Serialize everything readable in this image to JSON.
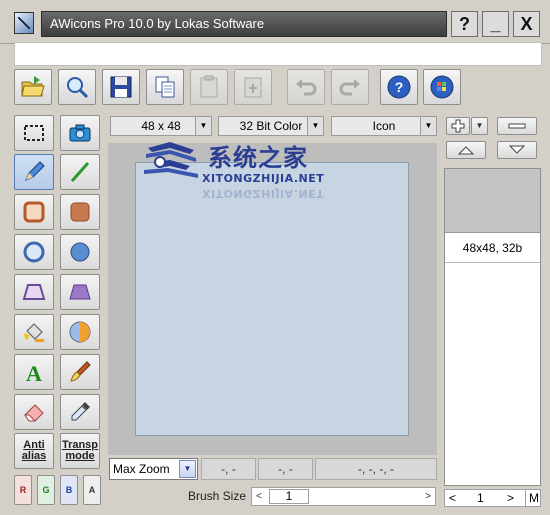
{
  "window": {
    "title": "AWicons Pro 10.0 by Lokas Software",
    "help_label": "?",
    "minimize_label": "_",
    "close_label": "X"
  },
  "toolbar": {
    "buttons": [
      {
        "name": "open",
        "icon": "folder-open-icon",
        "enabled": true
      },
      {
        "name": "find",
        "icon": "magnifier-icon",
        "enabled": true
      },
      {
        "name": "save",
        "icon": "floppy-disk-icon",
        "enabled": true
      },
      {
        "name": "copy",
        "icon": "copy-icon",
        "enabled": true
      },
      {
        "name": "paste",
        "icon": "paste-icon",
        "enabled": false
      },
      {
        "name": "paste-new",
        "icon": "paste-new-icon",
        "enabled": false
      },
      {
        "name": "undo",
        "icon": "undo-icon",
        "enabled": false
      },
      {
        "name": "redo",
        "icon": "redo-icon",
        "enabled": false
      },
      {
        "name": "help",
        "icon": "help-icon",
        "enabled": true
      },
      {
        "name": "windows",
        "icon": "windows-icon",
        "enabled": true
      }
    ]
  },
  "tools": {
    "antialias_label_1": "Anti",
    "antialias_label_2": "alias",
    "transp_label_1": "Transp",
    "transp_label_2": "mode",
    "channels": [
      "R",
      "G",
      "B",
      "A"
    ],
    "active_tool": "pencil"
  },
  "selectors": {
    "size": "48 x 48",
    "color_depth": "32 Bit Color",
    "type": "Icon"
  },
  "watermark": {
    "title": "系统之家",
    "subtitle": "XITONGZHIJIA.NET"
  },
  "status": {
    "zoom": "Max Zoom",
    "pos": "-, -",
    "size": "-, -",
    "rect": "-, -, -, -"
  },
  "brush": {
    "label": "Brush Size",
    "value": "1",
    "left_arrow": "<",
    "right_arrow": ">"
  },
  "icon_panel": {
    "add_label": "+",
    "remove_label": "−",
    "up_label": "▲",
    "down_label": "▼",
    "entries": [
      {
        "label": "48x48, 32b"
      }
    ],
    "page": "1",
    "mode": "M",
    "left_arrow": "<",
    "right_arrow": ">"
  },
  "colors": {
    "canvas_bg": "#c7d5e3",
    "title_bar": "#4a4a4a",
    "watermark_blue": "#2a3f93"
  }
}
